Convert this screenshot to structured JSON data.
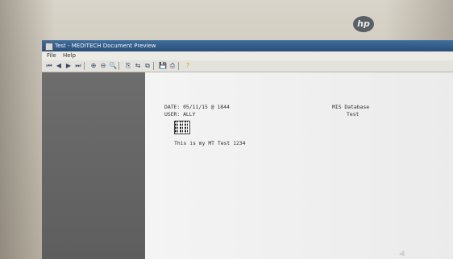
{
  "window": {
    "title": "Test - MEDITECH Document Preview"
  },
  "menu": {
    "items": [
      "File",
      "Help"
    ]
  },
  "toolbar": {
    "buttons": [
      {
        "icon": "first-page-icon",
        "glyph": "⏮"
      },
      {
        "icon": "prev-page-icon",
        "glyph": "◀"
      },
      {
        "icon": "next-page-icon",
        "glyph": "▶"
      },
      {
        "icon": "last-page-icon",
        "glyph": "⏭"
      },
      {
        "icon": "zoom-in-icon",
        "glyph": "⊕"
      },
      {
        "icon": "zoom-out-icon",
        "glyph": "⊖"
      },
      {
        "icon": "zoom-icon",
        "glyph": "🔍"
      },
      {
        "icon": "copy-icon",
        "glyph": "⎘"
      },
      {
        "icon": "find-icon",
        "glyph": "⇆"
      },
      {
        "icon": "paste-icon",
        "glyph": "⧉"
      },
      {
        "icon": "save-icon",
        "glyph": "💾"
      },
      {
        "icon": "print-icon",
        "glyph": "⎙"
      },
      {
        "icon": "help-icon",
        "glyph": "?"
      }
    ]
  },
  "document": {
    "date_line": "DATE: 05/11/15 @ 1844",
    "user_line": "USER: ALLY",
    "database_line": "MIS Database",
    "database_sub": "Test",
    "body_text": "This is my MT Test 1234"
  },
  "brand": {
    "logo_text": "hp"
  }
}
